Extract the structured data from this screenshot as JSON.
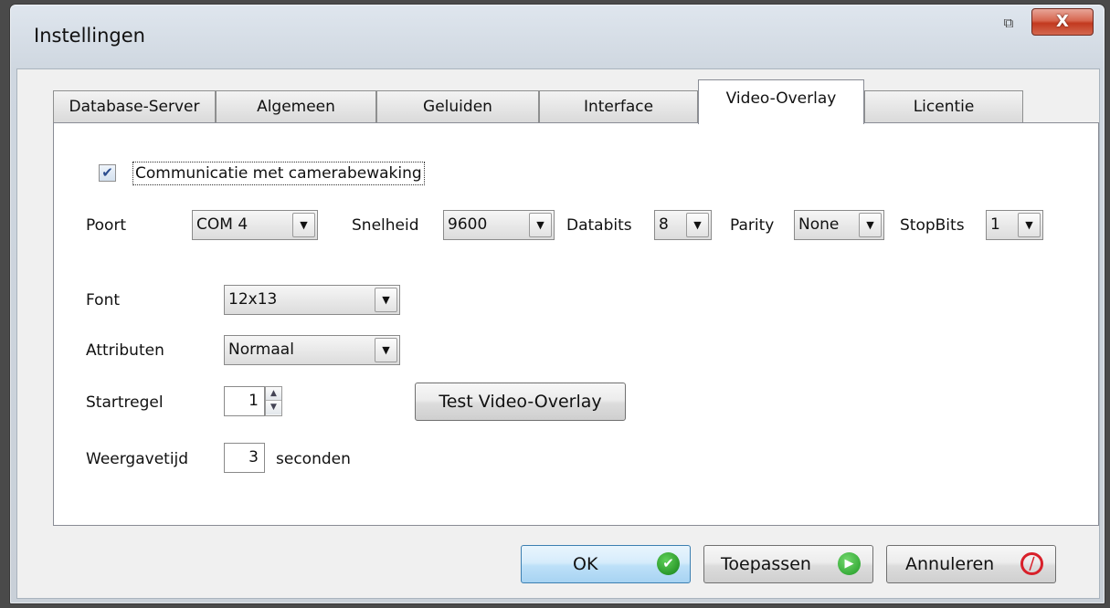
{
  "window": {
    "title": "Instellingen",
    "restore_glyph": "⧉",
    "close_glyph": "X"
  },
  "tabs": [
    {
      "label": "Database-Server",
      "active": false
    },
    {
      "label": "Algemeen",
      "active": false
    },
    {
      "label": "Geluiden",
      "active": false
    },
    {
      "label": "Interface",
      "active": false
    },
    {
      "label": "Video-Overlay",
      "active": true
    },
    {
      "label": "Licentie",
      "active": false
    }
  ],
  "video_overlay": {
    "camera_checkbox": {
      "label": "Communicatie met camerabewaking",
      "checked": true
    },
    "port": {
      "label": "Poort",
      "value": "COM 4"
    },
    "speed": {
      "label": "Snelheid",
      "value": "9600"
    },
    "databits": {
      "label": "Databits",
      "value": "8"
    },
    "parity": {
      "label": "Parity",
      "value": "None"
    },
    "stopbits": {
      "label": "StopBits",
      "value": "1"
    },
    "font": {
      "label": "Font",
      "value": "12x13"
    },
    "attributes": {
      "label": "Attributen",
      "value": "Normaal"
    },
    "start_line": {
      "label": "Startregel",
      "value": "1"
    },
    "test_button": "Test Video-Overlay",
    "display_time": {
      "label": "Weergavetijd",
      "value": "3",
      "unit": "seconden"
    }
  },
  "footer": {
    "ok": "OK",
    "apply": "Toepassen",
    "cancel": "Annuleren"
  },
  "icons": {
    "ok": "check-circle-icon",
    "apply": "arrow-circle-icon",
    "cancel": "prohibited-icon"
  }
}
